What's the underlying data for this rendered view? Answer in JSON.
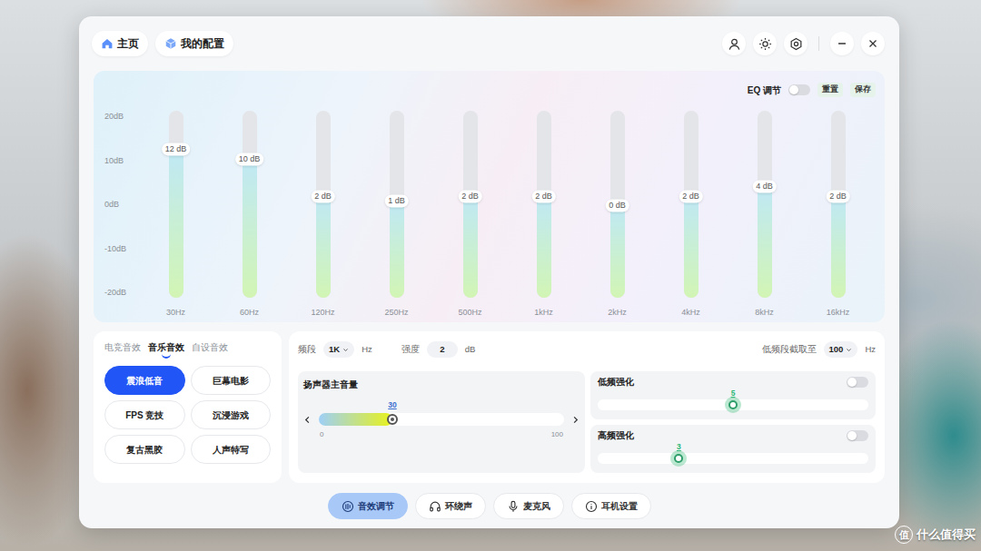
{
  "window": {
    "tabs": [
      {
        "label": "主页"
      },
      {
        "label": "我的配置"
      }
    ]
  },
  "eq": {
    "title": "EQ 调节",
    "enabled": false,
    "reset": "重置",
    "save": "保存",
    "axis": {
      "ticks": [
        "20dB",
        "10dB",
        "0dB",
        "-10dB",
        "-20dB"
      ]
    },
    "bands": [
      {
        "freq": "30Hz",
        "reading": "12 dB",
        "value": 12
      },
      {
        "freq": "60Hz",
        "reading": "10 dB",
        "value": 10
      },
      {
        "freq": "120Hz",
        "reading": "2 dB",
        "value": 2
      },
      {
        "freq": "250Hz",
        "reading": "1 dB",
        "value": 1
      },
      {
        "freq": "500Hz",
        "reading": "2 dB",
        "value": 2
      },
      {
        "freq": "1kHz",
        "reading": "2 dB",
        "value": 2
      },
      {
        "freq": "2kHz",
        "reading": "0 dB",
        "value": 0
      },
      {
        "freq": "4kHz",
        "reading": "2 dB",
        "value": 2
      },
      {
        "freq": "8kHz",
        "reading": "4 dB",
        "value": 4
      },
      {
        "freq": "16kHz",
        "reading": "2 dB",
        "value": 2
      }
    ]
  },
  "presets": {
    "tabs": [
      {
        "label": "电竞音效",
        "selected": false
      },
      {
        "label": "音乐音效",
        "selected": true
      },
      {
        "label": "自设音效",
        "selected": false
      }
    ],
    "items": [
      {
        "label": "震浪低音",
        "selected": true
      },
      {
        "label": "巨幕电影",
        "selected": false
      },
      {
        "label": "FPS 竞技",
        "selected": false
      },
      {
        "label": "沉浸游戏",
        "selected": false
      },
      {
        "label": "复古黑胶",
        "selected": false
      },
      {
        "label": "人声特写",
        "selected": false
      }
    ]
  },
  "controls": {
    "band": {
      "label": "频段",
      "value": "1K",
      "unit": "Hz"
    },
    "strength": {
      "label": "强度",
      "value": "2",
      "unit": "dB"
    },
    "cutoff": {
      "label": "低频段截取至",
      "value": "100",
      "unit": "Hz"
    },
    "volume": {
      "title": "扬声器主音量",
      "reading": "30",
      "level": 0.3,
      "min": "0",
      "max": "100"
    },
    "enhance": [
      {
        "title": "低频强化",
        "on": false,
        "reading": "5",
        "level": 0.5
      },
      {
        "title": "高频强化",
        "on": false,
        "reading": "3",
        "level": 0.3
      }
    ]
  },
  "bottom_nav": [
    {
      "label": "音效调节",
      "selected": true
    },
    {
      "label": "环绕声",
      "selected": false
    },
    {
      "label": "麦克风",
      "selected": false
    },
    {
      "label": "耳机设置",
      "selected": false
    }
  ],
  "watermark": {
    "logo": "值",
    "text": "什么值得买"
  }
}
